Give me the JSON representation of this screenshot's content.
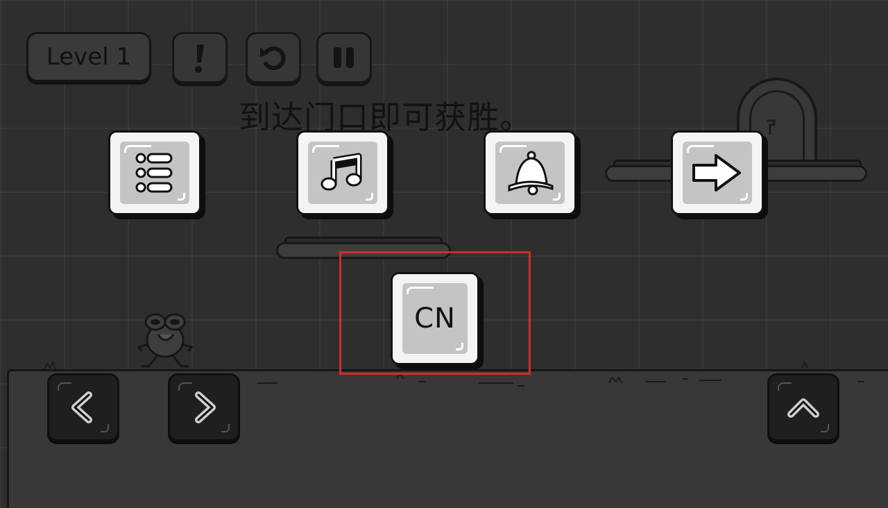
{
  "hud": {
    "level_label": "Level 1",
    "buttons": [
      {
        "name": "hint-button",
        "icon": "exclamation-icon"
      },
      {
        "name": "restart-button",
        "icon": "restart-icon"
      },
      {
        "name": "pause-button",
        "icon": "pause-icon"
      }
    ]
  },
  "hint": "到达门口即可获胜。",
  "settings": {
    "tiles": [
      {
        "name": "level-list-tile",
        "icon": "list-icon"
      },
      {
        "name": "music-tile",
        "icon": "music-note-icon"
      },
      {
        "name": "sound-tile",
        "icon": "bell-icon"
      },
      {
        "name": "next-tile",
        "icon": "arrow-right-icon"
      }
    ],
    "language_label": "CN"
  },
  "controls": {
    "left": "chevron-left-icon",
    "right": "chevron-right-icon",
    "jump": "chevron-up-icon"
  },
  "colors": {
    "background": "#2e2e2e",
    "tile": "#f4f4f4",
    "tile_inner": "#c4c4c4",
    "highlight": "#d42b2b"
  }
}
